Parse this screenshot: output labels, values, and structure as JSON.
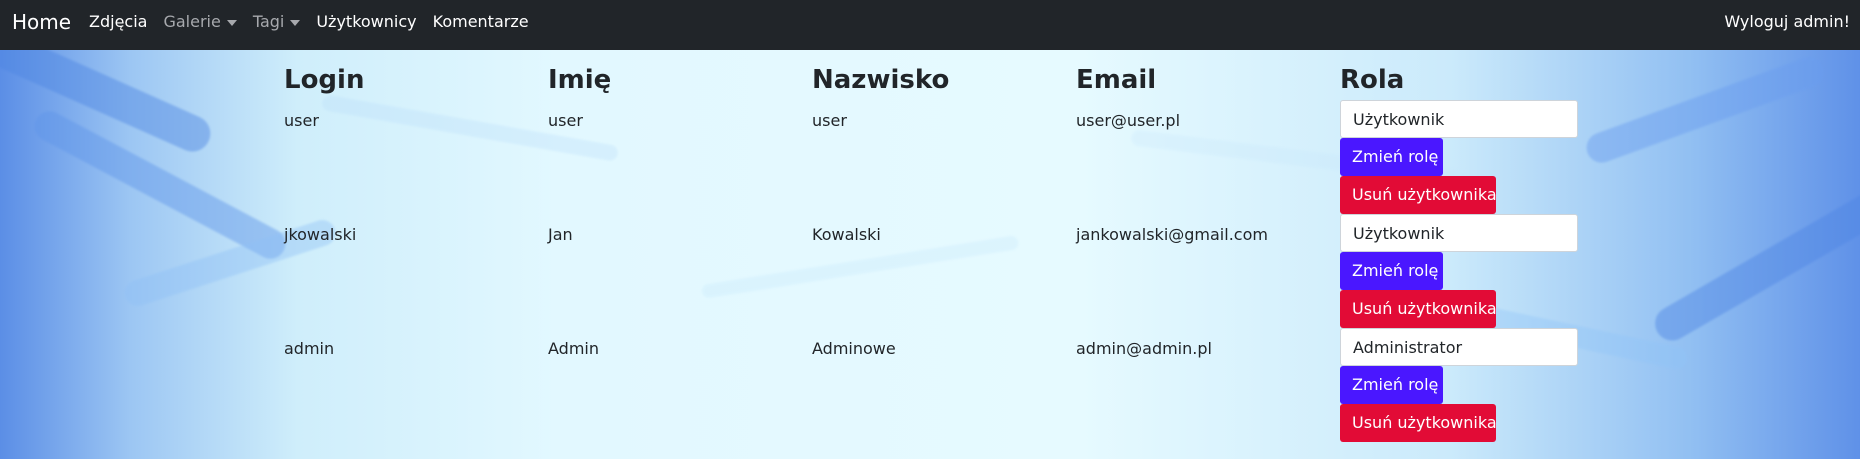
{
  "navbar": {
    "brand": "Home",
    "links": [
      {
        "label": "Zdjęcia"
      },
      {
        "label": "Galerie"
      },
      {
        "label": "Tagi"
      },
      {
        "label": "Użytkownicy"
      },
      {
        "label": "Komentarze"
      }
    ],
    "logout": "Wyloguj admin!"
  },
  "users_table": {
    "headers": {
      "login": "Login",
      "first_name": "Imię",
      "last_name": "Nazwisko",
      "email": "Email",
      "role": "Rola"
    },
    "rows": [
      {
        "login": "user",
        "first_name": "user",
        "last_name": "user",
        "email": "user@user.pl",
        "role": "Użytkownik",
        "change_role_label": "Zmień rolę",
        "delete_label": "Usuń użytkownika"
      },
      {
        "login": "jkowalski",
        "first_name": "Jan",
        "last_name": "Kowalski",
        "email": "jankowalski@gmail.com",
        "role": "Użytkownik",
        "change_role_label": "Zmień rolę",
        "delete_label": "Usuń użytkownika"
      },
      {
        "login": "admin",
        "first_name": "Admin",
        "last_name": "Adminowe",
        "email": "admin@admin.pl",
        "role": "Administrator",
        "change_role_label": "Zmień rolę",
        "delete_label": "Usuń użytkownika"
      }
    ]
  },
  "colors": {
    "navbar": "#212529",
    "muted_nav": "#a7a9ad",
    "change_button": "#4a17ff",
    "delete_button": "#e20b36"
  }
}
